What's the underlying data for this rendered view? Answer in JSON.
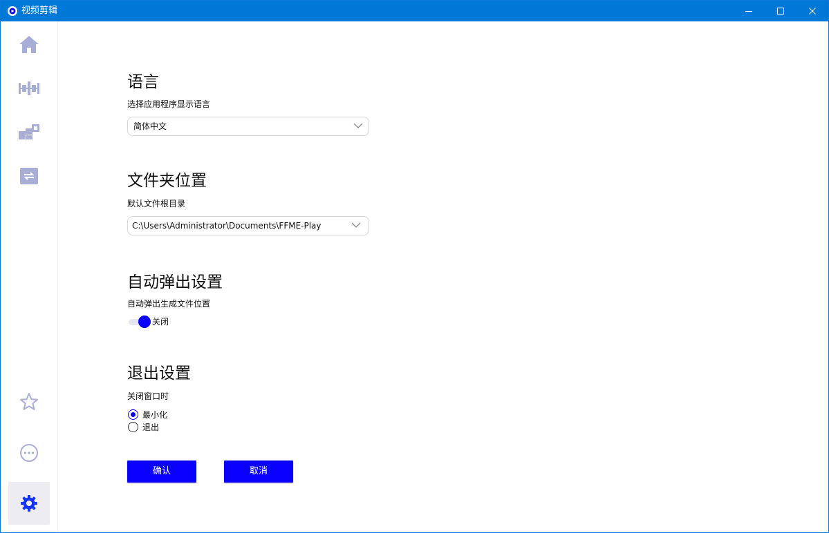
{
  "window": {
    "title": "视频剪辑",
    "accent_color": "#0078d7",
    "primary_color": "#0a00ff",
    "icon_color": "#a9aed6"
  },
  "sidebar": {
    "items": [
      {
        "icon": "home-icon"
      },
      {
        "icon": "timeline-icon"
      },
      {
        "icon": "blocks-icon"
      },
      {
        "icon": "convert-icon"
      },
      {
        "icon": "star-icon"
      },
      {
        "icon": "more-icon"
      },
      {
        "icon": "gear-icon",
        "active": true
      }
    ]
  },
  "settings": {
    "language": {
      "title": "语言",
      "description": "选择应用程序显示语言",
      "selected": "简体中文"
    },
    "folder": {
      "title": "文件夹位置",
      "description": "默认文件根目录",
      "selected": "C:\\Users\\Administrator\\Documents\\FFME-Play"
    },
    "auto_popup": {
      "title": "自动弹出设置",
      "description": "自动弹出生成文件位置",
      "toggle_label": "关闭"
    },
    "exit": {
      "title": "退出设置",
      "description": "关闭窗口时",
      "options": [
        {
          "label": "最小化",
          "checked": true
        },
        {
          "label": "退出",
          "checked": false
        }
      ]
    }
  },
  "buttons": {
    "confirm": "确认",
    "cancel": "取消"
  }
}
